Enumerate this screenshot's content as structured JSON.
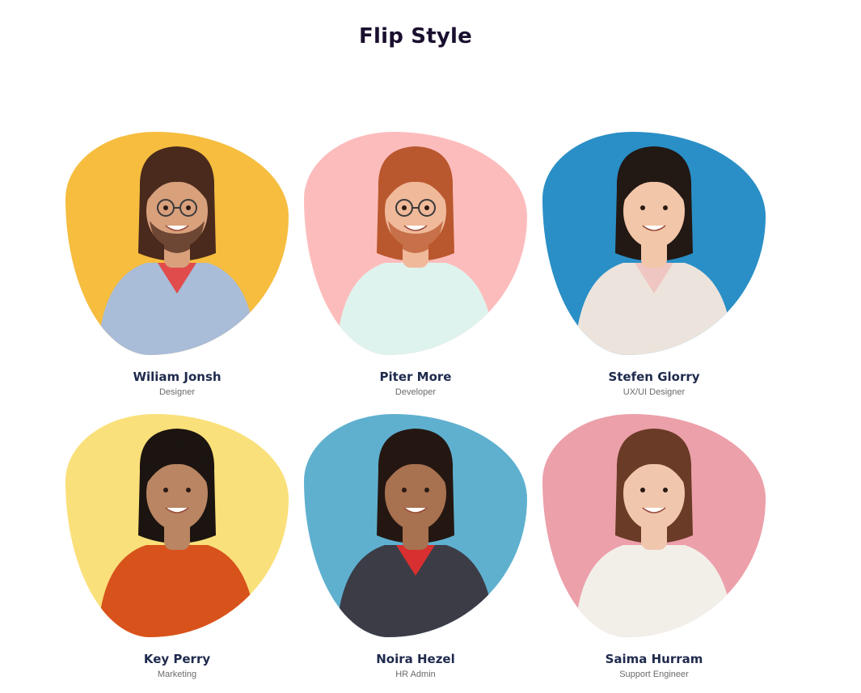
{
  "title": "Flip Style",
  "members": [
    {
      "name": "Wiliam Jonsh",
      "role": "Designer",
      "bg": "#f6bd3f",
      "skin": "#d9a07c",
      "hair": "#4a2a1c",
      "shirt": "#a9bcd8",
      "inner": "#e04b4b",
      "glasses": true,
      "beard": true
    },
    {
      "name": "Piter More",
      "role": "Developer",
      "bg": "#fdbcbc",
      "skin": "#f0b99a",
      "hair": "#b9582e",
      "shirt": "#dff3ee",
      "inner": "#dff3ee",
      "glasses": true,
      "beard": true
    },
    {
      "name": "Stefen Glorry",
      "role": "UX/UI Designer",
      "bg": "#2a8fc6",
      "skin": "#f2c6a8",
      "hair": "#221814",
      "shirt": "#ece4dc",
      "inner": "#f0c6c2",
      "glasses": false,
      "beard": false
    },
    {
      "name": "Key Perry",
      "role": "Marketing",
      "bg": "#fae07a",
      "skin": "#b98562",
      "hair": "#1b1410",
      "shirt": "#d8521c",
      "inner": "#d8521c",
      "glasses": false,
      "beard": false
    },
    {
      "name": "Noira Hezel",
      "role": "HR Admin",
      "bg": "#5fb0cf",
      "skin": "#a8714f",
      "hair": "#241712",
      "shirt": "#3c3c46",
      "inner": "#d83030",
      "glasses": false,
      "beard": false
    },
    {
      "name": "Saima Hurram",
      "role": "Support Engineer",
      "bg": "#eca0aa",
      "skin": "#f0c7ad",
      "hair": "#6a3b26",
      "shirt": "#f2efe9",
      "inner": "#f2efe9",
      "glasses": false,
      "beard": false
    }
  ]
}
